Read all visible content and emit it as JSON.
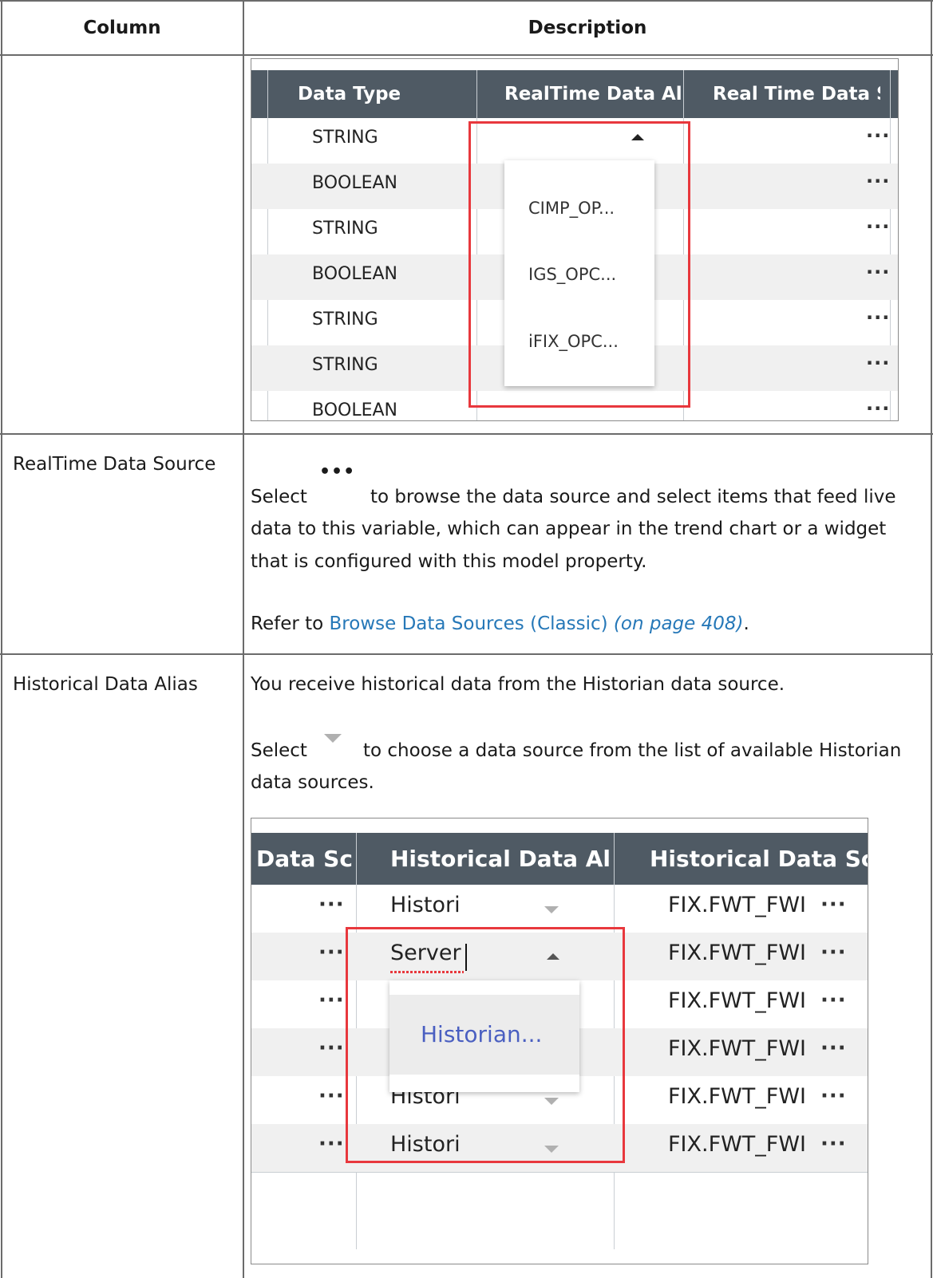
{
  "table": {
    "header_column": "Column",
    "header_description": "Description"
  },
  "screenshot1": {
    "headers": [
      "Data Type",
      "RealTime Data Ali",
      "Real Time Data Sc"
    ],
    "rows": [
      "STRING",
      "BOOLEAN",
      "STRING",
      "BOOLEAN",
      "STRING",
      "STRING",
      "BOOLEAN"
    ],
    "dots": "···",
    "dropdown_items": [
      "CIMP_OP...",
      "IGS_OPC...",
      "iFIX_OPC..."
    ]
  },
  "row_realtime_source": {
    "column": "RealTime Data Source",
    "select_word": "Select",
    "icon": "ellipsis-icon",
    "line1": "to browse the data source and select items that feed live",
    "line2": "data to this variable, which can appear in the trend chart or a widget",
    "line3": "that is configured with this model property.",
    "refer_prefix": "Refer to ",
    "refer_link": "Browse Data Sources (Classic)",
    "refer_page": "(on page 408)",
    "refer_suffix": "."
  },
  "row_historical_alias": {
    "column": "Historical Data Alias",
    "intro": "You receive historical data from the Historian data source.",
    "select_word": "Select",
    "icon": "dropdown-arrow-icon",
    "line1": "to choose a data source from the list of available Historian",
    "line2": "data sources."
  },
  "screenshot2": {
    "headers": [
      "Data Sc",
      "Historical Data Al",
      "Historical Data Sc"
    ],
    "dots": "···",
    "rows": [
      {
        "alias": "Histori",
        "source": "FIX.FWT_FWI"
      },
      {
        "alias": "Server",
        "source": "FIX.FWT_FWI"
      },
      {
        "alias": "",
        "source": "FIX.FWT_FWI"
      },
      {
        "alias": "",
        "source": "FIX.FWT_FWI"
      },
      {
        "alias": "Histori",
        "source": "FIX.FWT_FWI"
      },
      {
        "alias": "Histori",
        "source": "FIX.FWT_FWI"
      }
    ],
    "dropdown_item": "Historian..."
  }
}
